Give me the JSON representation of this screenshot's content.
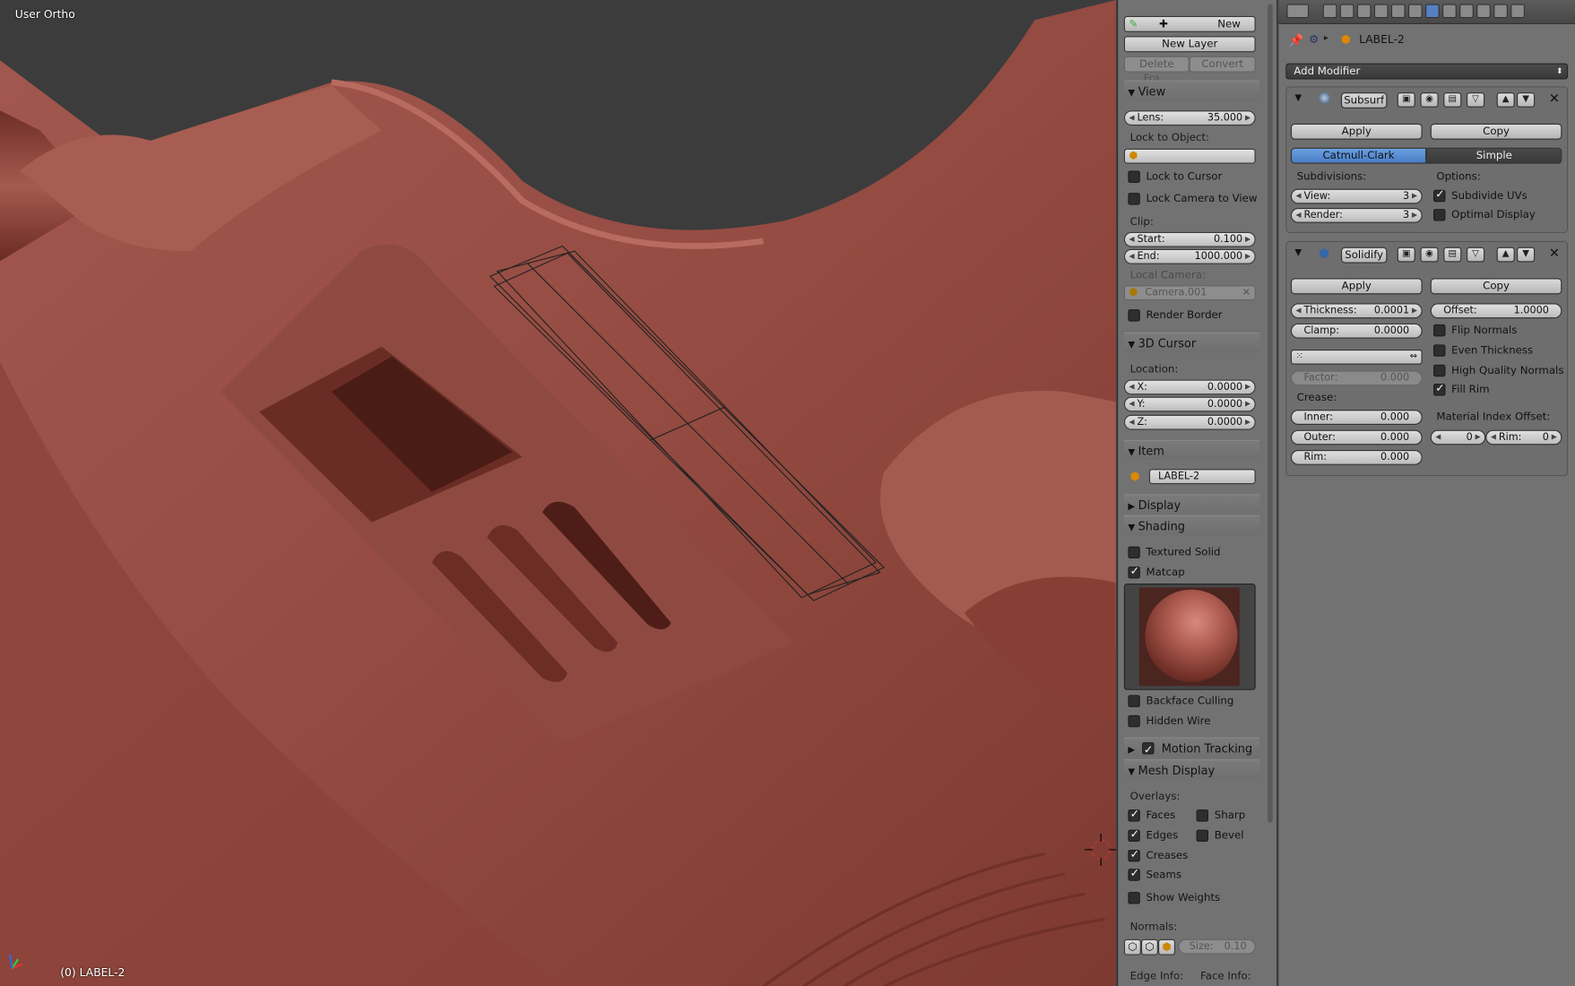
{
  "viewport": {
    "view_name": "User Ortho",
    "object_label": "(0) LABEL-2"
  },
  "npanel": {
    "grease_pencil": {
      "new_label": "New",
      "new_layer_label": "New Layer",
      "delete_frame_label": "Delete Fra...",
      "convert_label": "Convert"
    },
    "view": {
      "header": "View",
      "lens_label": "Lens:",
      "lens_value": "35.000",
      "lock_to_object_label": "Lock to Object:",
      "lock_to_cursor_label": "Lock to Cursor",
      "lock_camera_label": "Lock Camera to View",
      "clip_label": "Clip:",
      "clip_start_label": "Start:",
      "clip_start_value": "0.100",
      "clip_end_label": "End:",
      "clip_end_value": "1000.000",
      "local_camera_label": "Local Camera:",
      "local_camera_value": "Camera.001",
      "render_border_label": "Render Border"
    },
    "cursor": {
      "header": "3D Cursor",
      "location_label": "Location:",
      "x_label": "X:",
      "x_value": "0.0000",
      "y_label": "Y:",
      "y_value": "0.0000",
      "z_label": "Z:",
      "z_value": "0.0000"
    },
    "item": {
      "header": "Item",
      "name": "LABEL-2"
    },
    "display": {
      "header": "Display"
    },
    "shading": {
      "header": "Shading",
      "textured_solid_label": "Textured Solid",
      "matcap_label": "Matcap",
      "backface_label": "Backface Culling",
      "hidden_wire_label": "Hidden Wire"
    },
    "motion_tracking": {
      "header": "Motion Tracking"
    },
    "mesh_display": {
      "header": "Mesh Display",
      "overlays_label": "Overlays:",
      "faces_label": "Faces",
      "sharp_label": "Sharp",
      "edges_label": "Edges",
      "bevel_label": "Bevel",
      "creases_label": "Creases",
      "seams_label": "Seams",
      "show_weights_label": "Show Weights",
      "normals_label": "Normals:",
      "size_label": "Size:",
      "size_value": "0.10",
      "edge_info_label": "Edge Info:",
      "face_info_label": "Face Info:"
    }
  },
  "properties": {
    "breadcrumb_object": "LABEL-2",
    "add_modifier_label": "Add Modifier",
    "subsurf": {
      "name": "Subsurf",
      "apply_label": "Apply",
      "copy_label": "Copy",
      "catmull_label": "Catmull-Clark",
      "simple_label": "Simple",
      "subdivisions_label": "Subdivisions:",
      "options_label": "Options:",
      "view_label": "View:",
      "view_value": "3",
      "render_label": "Render:",
      "render_value": "3",
      "subdivide_uvs_label": "Subdivide UVs",
      "optimal_display_label": "Optimal Display"
    },
    "solidify": {
      "name": "Solidify",
      "apply_label": "Apply",
      "copy_label": "Copy",
      "thickness_label": "Thickness:",
      "thickness_value": "0.0001",
      "offset_label": "Offset:",
      "offset_value": "1.0000",
      "clamp_label": "Clamp:",
      "clamp_value": "0.0000",
      "flip_normals_label": "Flip Normals",
      "even_thickness_label": "Even Thickness",
      "high_quality_label": "High Quality Normals",
      "fill_rim_label": "Fill Rim",
      "factor_label": "Factor:",
      "factor_value": "0.000",
      "crease_label": "Crease:",
      "inner_label": "Inner:",
      "inner_value": "0.000",
      "outer_label": "Outer:",
      "outer_value": "0.000",
      "rim_label": "Rim:",
      "rim_value": "0.000",
      "material_index_label": "Material Index Offset:",
      "mat_offset_value": "0",
      "mat_rim_label": "Rim:",
      "mat_rim_value": "0"
    }
  }
}
